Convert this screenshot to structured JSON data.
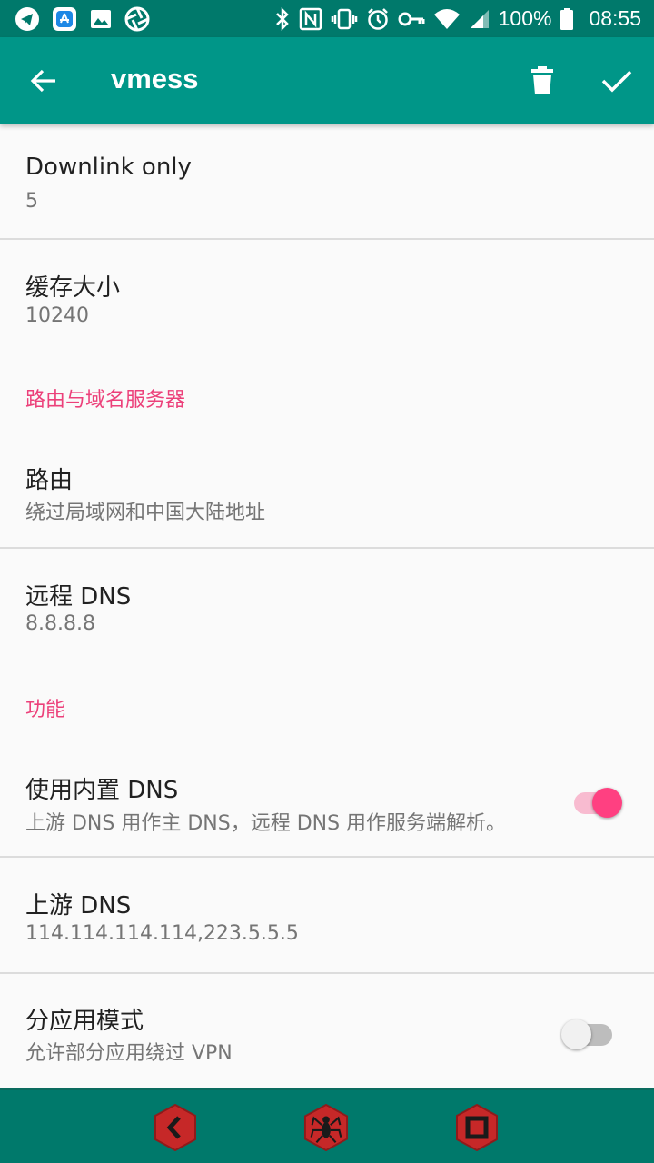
{
  "status_bar": {
    "battery": "100%",
    "time": "08:55",
    "left_icons": [
      "telegram-icon",
      "app-store-icon",
      "gallery-icon",
      "aperture-icon"
    ],
    "right_icons": [
      "bluetooth-icon",
      "nfc-icon",
      "vibrate-icon",
      "alarm-icon",
      "vpn-key-icon",
      "wifi-icon",
      "signal-icon",
      "battery-icon"
    ]
  },
  "appbar": {
    "title": "vmess",
    "back_icon": "arrow-back-icon",
    "delete_icon": "trash-icon",
    "confirm_icon": "check-icon"
  },
  "prefs": {
    "downlink": {
      "title": "Downlink only",
      "summary": "5"
    },
    "cache": {
      "title": "缓存大小",
      "summary": "10240"
    },
    "category_route": "路由与域名服务器",
    "route": {
      "title": "路由",
      "summary": "绕过局域网和中国大陆地址"
    },
    "remote_dns": {
      "title": "远程 DNS",
      "summary": "8.8.8.8"
    },
    "category_features": "功能",
    "builtin_dns": {
      "title": "使用内置 DNS",
      "summary": "上游 DNS 用作主 DNS，远程 DNS 用作服务端解析。",
      "enabled": true
    },
    "upstream_dns": {
      "title": "上游 DNS",
      "summary": "114.114.114.114,223.5.5.5"
    },
    "per_app": {
      "title": "分应用模式",
      "summary": "允许部分应用绕过 VPN",
      "enabled": false
    }
  },
  "colors": {
    "status_bar": "#00796b",
    "app_bar": "#009688",
    "accent": "#ff4081",
    "category": "#ec407a",
    "nav_button": "#c62828"
  },
  "bottom_nav": [
    "back-hex-icon",
    "spider-hex-icon",
    "stop-hex-icon"
  ]
}
